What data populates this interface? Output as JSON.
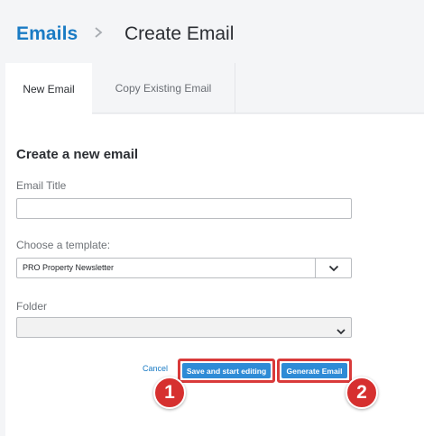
{
  "breadcrumb": {
    "parent": "Emails",
    "separator": ">",
    "current": "Create Email"
  },
  "tabs": [
    {
      "label": "New Email",
      "active": true
    },
    {
      "label": "Copy Existing Email",
      "active": false
    }
  ],
  "form": {
    "section_title": "Create a new email",
    "email_title": {
      "label": "Email Title",
      "value": "",
      "placeholder": ""
    },
    "template": {
      "label": "Choose a template:",
      "selected": "PRO Property Newsletter",
      "icon": "chevron-down-icon"
    },
    "folder": {
      "label": "Folder",
      "selected": "",
      "icon": "chevron-down-icon"
    }
  },
  "actions": {
    "cancel_label": "Cancel",
    "save_label": "Save and start editing",
    "generate_label": "Generate Email"
  },
  "annotations": [
    {
      "label": "1",
      "color": "#d6302f"
    },
    {
      "label": "2",
      "color": "#d6302f"
    }
  ],
  "colors": {
    "accent": "#1a7bc4",
    "button": "#2e8bd6",
    "highlight": "#d93a3a"
  }
}
